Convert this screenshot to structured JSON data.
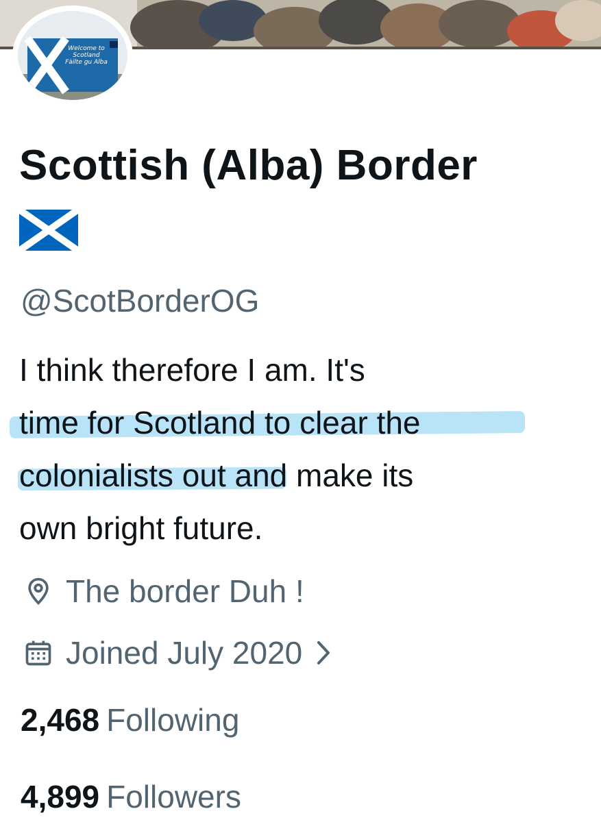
{
  "profile": {
    "display_name": "Scottish (Alba) Border",
    "name_emoji": "saltire-flag-icon",
    "handle": "@ScotBorderOG",
    "avatar_sign": {
      "line1": "Welcome to",
      "line2": "Scotland",
      "line3": "Fàilte gu Alba"
    },
    "bio_lines": [
      "I think therefore I am. It's",
      "time for Scotland to clear the",
      "colonialists out and make its",
      "own bright future."
    ],
    "location": "The border Duh !",
    "location_icon": "location-pin-icon",
    "joined": "Joined July 2020",
    "joined_icon": "calendar-icon",
    "following_count": "2,468",
    "following_label": "Following",
    "followers_count": "4,899",
    "followers_label": "Followers"
  },
  "colors": {
    "text_primary": "#0f1419",
    "text_secondary": "#536471",
    "highlight": "#4fb8ec",
    "saltire_blue": "#0065bd"
  }
}
